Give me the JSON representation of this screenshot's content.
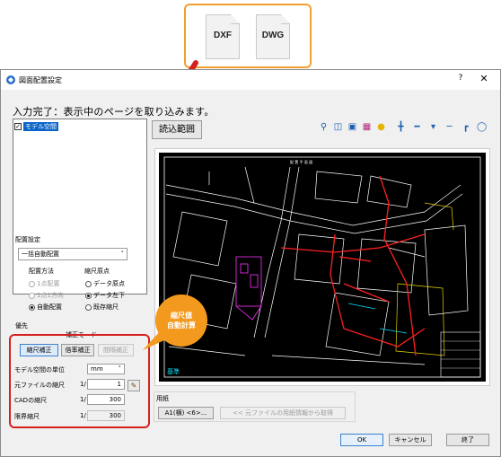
{
  "callout": {
    "files": [
      "DXF",
      "DWG"
    ],
    "border_color": "#f0a030"
  },
  "dialog": {
    "title": "図面配置設定",
    "help": "?",
    "close": "✕",
    "status": "入力完了：表示中のページを取り込みます。"
  },
  "model_list": {
    "items": [
      {
        "label": "モデル空間",
        "checked": true
      }
    ]
  },
  "read_range_button": "読込範囲",
  "toolbar_icons": [
    "magnifier-icon",
    "print-preview-icon",
    "fit-icon",
    "layer-icon",
    "bulb-icon",
    "snap-point-icon",
    "snap-line-icon",
    "snap-extend-icon",
    "snap-mid-icon",
    "snap-tangent-icon",
    "snap-circle-icon"
  ],
  "placement": {
    "group_label": "配置設定",
    "mode_selected": "一括自動配置",
    "method_label": "配置方法",
    "origin_label": "縮尺原点",
    "methods": [
      {
        "label": "1点配置",
        "selected": false,
        "enabled": false
      },
      {
        "label": "1点1方向",
        "selected": false,
        "enabled": false
      },
      {
        "label": "自動配置",
        "selected": true,
        "enabled": true
      }
    ],
    "origins": [
      {
        "label": "データ原点",
        "selected": false
      },
      {
        "label": "データ左下",
        "selected": true
      },
      {
        "label": "既存縮尺",
        "selected": false
      }
    ]
  },
  "priority": {
    "group_label": "優先",
    "mode_label": "補正モード",
    "modes": [
      {
        "label": "縮尺補正",
        "state": "active"
      },
      {
        "label": "倍率補正",
        "state": "normal"
      },
      {
        "label": "間隔補正",
        "state": "disabled"
      }
    ],
    "unit_label": "モデル空間の単位",
    "unit_value": "mm",
    "rows": [
      {
        "label": "元ファイルの縮尺",
        "prefix": "1/",
        "value": "1"
      },
      {
        "label": "CADの縮尺",
        "prefix": "1/",
        "value": "300"
      },
      {
        "label": "限界縮尺",
        "prefix": "1/",
        "value": "300"
      }
    ]
  },
  "bubble": {
    "lines": [
      "縮尺値",
      "自動計算"
    ],
    "color": "#f39a1e"
  },
  "paper": {
    "group_label": "用紙",
    "size_button": "A1(横) <6>...",
    "from_file_button": "<< 元ファイルの用紙情報から取得"
  },
  "preview": {
    "corner_label": "基準",
    "title_text": "配 置 平 面 図"
  },
  "footer": {
    "ok": "OK",
    "cancel": "キャンセル",
    "close": "終了"
  },
  "colors": {
    "accent": "#0a64c8",
    "highlight_red": "#d62020"
  }
}
